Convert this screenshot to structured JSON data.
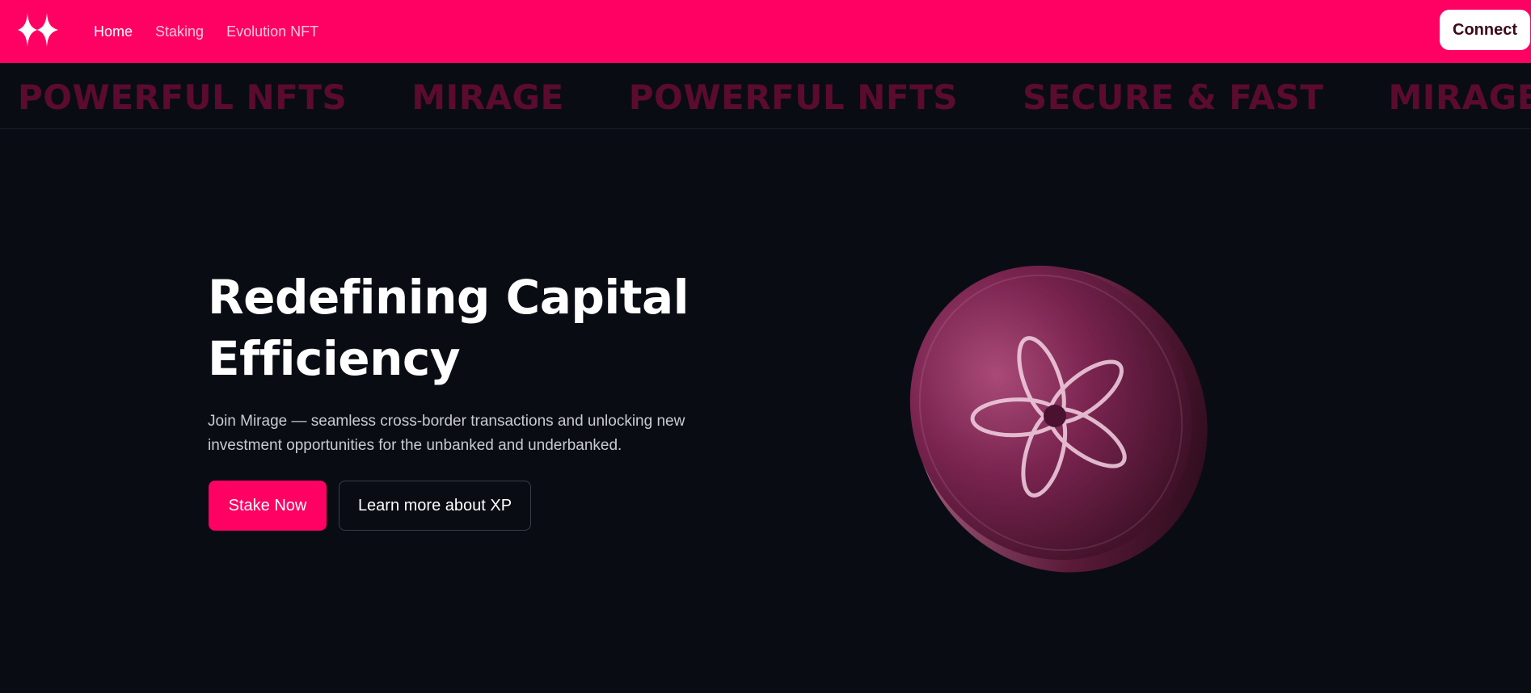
{
  "nav": {
    "links": [
      "Home",
      "Staking",
      "Evolution NFT"
    ],
    "connect_label": "Connect"
  },
  "marquee": {
    "items": [
      "POWERFUL NFTS",
      "MIRAGE",
      "POWERFUL NFTS",
      "SECURE & FAST",
      "MIRAGE"
    ]
  },
  "hero": {
    "title": "Redefining Capital Efficiency",
    "description": "Join Mirage — seamless cross-border transactions and unlocking new investment opportunities for the unbanked and underbanked.",
    "primary_button": "Stake Now",
    "secondary_button": "Learn more about XP"
  },
  "icons": {
    "logo": "mirage-star-logo-icon",
    "coin": "flower-coin-icon"
  },
  "colors": {
    "brand": "#ff0063",
    "background": "#0a0c14",
    "marquee_text": "#5b0b2e",
    "coin": "#8a2d5a"
  }
}
